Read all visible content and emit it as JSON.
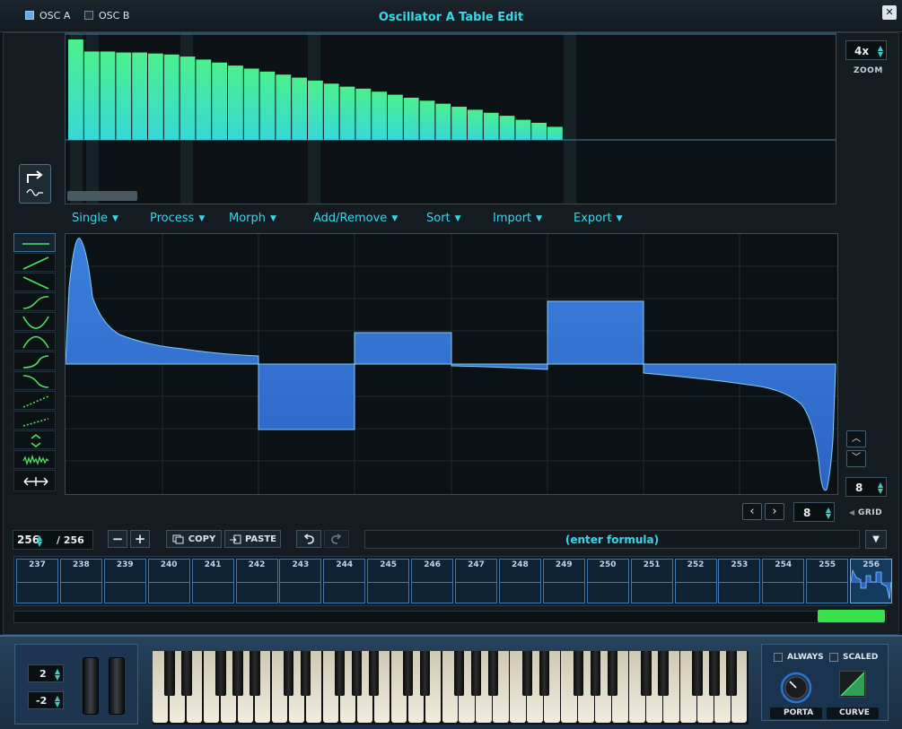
{
  "window": {
    "title": "Oscillator A Table Edit",
    "tabs": [
      {
        "label": "OSC A",
        "checked": true
      },
      {
        "label": "OSC B",
        "checked": false
      }
    ],
    "close_icon": "close-icon"
  },
  "zoom": {
    "value": "4x",
    "label": "ZOOM"
  },
  "overview_bars": [
    1.0,
    0.88,
    0.88,
    0.87,
    0.87,
    0.86,
    0.85,
    0.83,
    0.8,
    0.77,
    0.74,
    0.71,
    0.68,
    0.65,
    0.62,
    0.59,
    0.56,
    0.53,
    0.51,
    0.48,
    0.45,
    0.42,
    0.39,
    0.36,
    0.33,
    0.3,
    0.27,
    0.24,
    0.2,
    0.17,
    0.13
  ],
  "menus": [
    "Single",
    "Process",
    "Morph",
    "Add/Remove",
    "Sort",
    "Import",
    "Export"
  ],
  "shape_tools": [
    "flat-line-icon",
    "rising-line-icon",
    "falling-line-icon",
    "sine-up-icon",
    "curve-down-icon",
    "curve-up-icon",
    "s-curve-up-icon",
    "s-curve-down-icon",
    "dotted-ramp-up-icon",
    "dotted-ramp-icon",
    "expand-icon",
    "noise-icon",
    "stretch-icon"
  ],
  "grid": {
    "label": "GRID",
    "value_side": "8",
    "value_bottom": "8"
  },
  "toolbar": {
    "frame_current": "256",
    "frame_total": "/ 256",
    "minus": "−",
    "plus": "+",
    "copy_label": "COPY",
    "paste_label": "PASTE",
    "undo_icon": "undo-icon",
    "redo_icon": "redo-icon",
    "formula_placeholder": "(enter formula)"
  },
  "frames": [
    "237",
    "238",
    "239",
    "240",
    "241",
    "242",
    "243",
    "244",
    "245",
    "246",
    "247",
    "248",
    "249",
    "250",
    "251",
    "252",
    "253",
    "254",
    "255",
    "256"
  ],
  "keyboard": {
    "pitch_up": "2",
    "pitch_down": "-2",
    "always_label": "ALWAYS",
    "scaled_label": "SCALED",
    "porta_label": "PORTA",
    "curve_label": "CURVE"
  },
  "colors": {
    "accent": "#3ad6e8",
    "wave_fill": "#2f6ed0",
    "bar_top": "#4cf08c",
    "bar_bottom": "#36d8d8",
    "green_scroll": "#39e14a"
  }
}
